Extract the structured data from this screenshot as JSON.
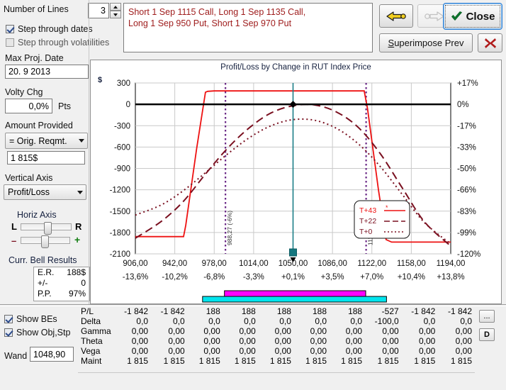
{
  "controls": {
    "number_of_lines_label": "Number of Lines",
    "number_of_lines_value": "3",
    "step_dates_label": "Step through dates",
    "step_dates_checked": true,
    "step_vols_label": "Step through volatilities",
    "step_vols_checked": false,
    "max_proj_date_label": "Max Proj. Date",
    "max_proj_date_value": "20. 9 2013",
    "volty_chg_label": "Volty Chg",
    "volty_chg_value": "0,0%",
    "volty_chg_units": "Pts",
    "amount_provided_label": "Amount Provided",
    "amount_provided_value": "= Orig. Reqmt.",
    "amount_value": "1 815$",
    "vertical_axis_label": "Vertical Axis",
    "vertical_axis_value": "Profit/Loss",
    "horiz_axis_label": "Horiz Axis",
    "horiz_left": "L",
    "horiz_right": "R",
    "zoom_minus": "–",
    "zoom_plus": "+",
    "show_bes_label": "Show BEs",
    "show_bes_checked": true,
    "show_objstp_label": "Show Obj,Stp",
    "show_objstp_checked": true,
    "wand_label": "Wand",
    "wand_value": "1048,90"
  },
  "bell_results": {
    "title": "Curr. Bell Results",
    "rows": [
      {
        "label": "E.R.",
        "value": "188$"
      },
      {
        "label": "+/-",
        "value": "0"
      },
      {
        "label": "P.P.",
        "value": "97%"
      }
    ]
  },
  "position": {
    "text_line1": "Short 1 Sep 1115 Call, Long 1 Sep 1135 Call,",
    "text_line2": "Long 1 Sep 950 Put, Short 1 Sep 970 Put",
    "color": "#9e1b1b"
  },
  "toolbar": {
    "back_label": "",
    "forward_label": "",
    "close_label": "Close",
    "superimpose_label": "Superimpose Prev",
    "superimpose_accel": "S",
    "cancel_label": ""
  },
  "greeks": {
    "row_labels": [
      "P/L",
      "Delta",
      "Gamma",
      "Theta",
      "Vega",
      "Maint"
    ],
    "columns": [
      {
        "P/L": "-1 842",
        "Delta": "0,0",
        "Gamma": "0,00",
        "Theta": "0,00",
        "Vega": "0,00",
        "Maint": "1 815"
      },
      {
        "P/L": "-1 842",
        "Delta": "0,0",
        "Gamma": "0,00",
        "Theta": "0,00",
        "Vega": "0,00",
        "Maint": "1 815"
      },
      {
        "P/L": "188",
        "Delta": "0,0",
        "Gamma": "0,00",
        "Theta": "0,00",
        "Vega": "0,00",
        "Maint": "1 815"
      },
      {
        "P/L": "188",
        "Delta": "0,0",
        "Gamma": "0,00",
        "Theta": "0,00",
        "Vega": "0,00",
        "Maint": "1 815"
      },
      {
        "P/L": "188",
        "Delta": "0,0",
        "Gamma": "0,00",
        "Theta": "0,00",
        "Vega": "0,00",
        "Maint": "1 815"
      },
      {
        "P/L": "188",
        "Delta": "0,0",
        "Gamma": "0,00",
        "Theta": "0,00",
        "Vega": "0,00",
        "Maint": "1 815"
      },
      {
        "P/L": "188",
        "Delta": "0,0",
        "Gamma": "0,00",
        "Theta": "0,00",
        "Vega": "0,00",
        "Maint": "1 815"
      },
      {
        "P/L": "-527",
        "Delta": "-100,0",
        "Gamma": "0,00",
        "Theta": "0,00",
        "Vega": "0,00",
        "Maint": "1 815"
      },
      {
        "P/L": "-1 842",
        "Delta": "0,0",
        "Gamma": "0,00",
        "Theta": "0,00",
        "Vega": "0,00",
        "Maint": "1 815"
      },
      {
        "P/L": "-1 842",
        "Delta": "0,0",
        "Gamma": "0,00",
        "Theta": "0,00",
        "Vega": "0,00",
        "Maint": "1 815"
      }
    ],
    "dots_button_label": "...",
    "d_button_label": "D"
  },
  "chart_data": {
    "type": "line",
    "title": "Profit/Loss by Change in RUT Index Price",
    "ylabel": "$",
    "xlabel": "",
    "ylim": [
      -2100,
      300
    ],
    "yticks": [
      300,
      0,
      -300,
      -600,
      -900,
      -1200,
      -1500,
      -1800,
      -2100
    ],
    "y2ticks": [
      "+17%",
      "0%",
      "-17%",
      "-33%",
      "-50%",
      "-66%",
      "-83%",
      "-99%",
      "-120%"
    ],
    "xlim": [
      906,
      1194
    ],
    "xticks": [
      906,
      942,
      978,
      1014,
      1050,
      1086,
      1122,
      1158,
      1194
    ],
    "xticklabels": [
      "906,00",
      "942,00",
      "978,00",
      "1014,00",
      "1050,00",
      "1086,00",
      "1122,00",
      "1158,00",
      "1194,00"
    ],
    "xticklabels_pct": [
      "-13,6%",
      "-10,2%",
      "-6,8%",
      "-3,3%",
      "+0,1%",
      "+3,5%",
      "+7,0%",
      "+10,4%",
      "+13,8%"
    ],
    "legend_position": "right-middle",
    "grid": true,
    "series": [
      {
        "name": "T+43",
        "color": "#ee1111",
        "style": "solid",
        "x": [
          906,
          942,
          950,
          952,
          962,
          970,
          972,
          978,
          1050,
          1110,
          1115,
          1118,
          1128,
          1135,
          1140,
          1194
        ],
        "y": [
          -1858,
          -1858,
          -1858,
          -1700,
          -620,
          170,
          182,
          188,
          188,
          188,
          188,
          -60,
          -1200,
          -1900,
          -1935,
          -1935
        ]
      },
      {
        "name": "T+22",
        "color": "#7a1020",
        "style": "dashed",
        "x": [
          906,
          930,
          950,
          970,
          990,
          1010,
          1030,
          1050,
          1070,
          1090,
          1110,
          1130,
          1150,
          1170,
          1194
        ],
        "y": [
          -1880,
          -1640,
          -1360,
          -980,
          -620,
          -330,
          -120,
          -20,
          -10,
          -110,
          -330,
          -700,
          -1180,
          -1650,
          -1990
        ]
      },
      {
        "name": "T+0",
        "color": "#7a1020",
        "style": "dotted",
        "x": [
          906,
          930,
          950,
          970,
          990,
          1010,
          1030,
          1050,
          1070,
          1090,
          1110,
          1130,
          1150,
          1170,
          1194
        ],
        "y": [
          -1555,
          -1410,
          -1210,
          -960,
          -700,
          -470,
          -300,
          -215,
          -225,
          -340,
          -560,
          -880,
          -1270,
          -1660,
          -1960
        ]
      }
    ],
    "zero_line": 0,
    "cursor_line": {
      "x": 1050,
      "label": "1050,00",
      "marker_y": 0
    },
    "breakeven_lines": [
      {
        "x": 988.27,
        "label": "988,27 (-6%)",
        "color": "#6b2a87"
      },
      {
        "x": 1116.73,
        "label": "1116,73 (+6%)",
        "color": "#6b2a87"
      }
    ],
    "range_bars": [
      {
        "name": "objective-bar",
        "color": "#ff00ff",
        "x0": 988,
        "x1": 1117
      },
      {
        "name": "stop-bar",
        "color": "#00e5ee",
        "x0": 968,
        "x1": 1136
      }
    ]
  }
}
